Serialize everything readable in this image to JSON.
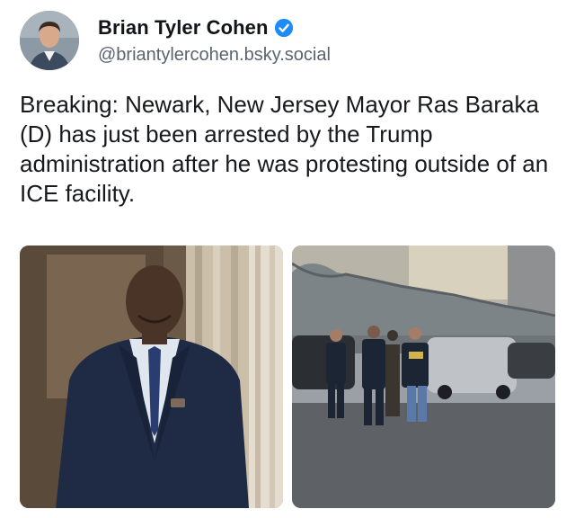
{
  "post": {
    "author": {
      "display_name": "Brian Tyler Cohen",
      "handle": "@briantylercohen.bsky.social",
      "verified": true,
      "avatar_icon": "profile-photo"
    },
    "text": "Breaking: Newark, New Jersey Mayor Ras Baraka (D) has just been arrested by the Trump administration after he was protesting outside of an ICE facility.",
    "media": [
      {
        "icon": "portrait-photo"
      },
      {
        "icon": "arrest-scene-photo"
      }
    ],
    "colors": {
      "verified_badge": "#1d8cf8",
      "text": "#17191c",
      "handle": "#5a6470"
    }
  }
}
